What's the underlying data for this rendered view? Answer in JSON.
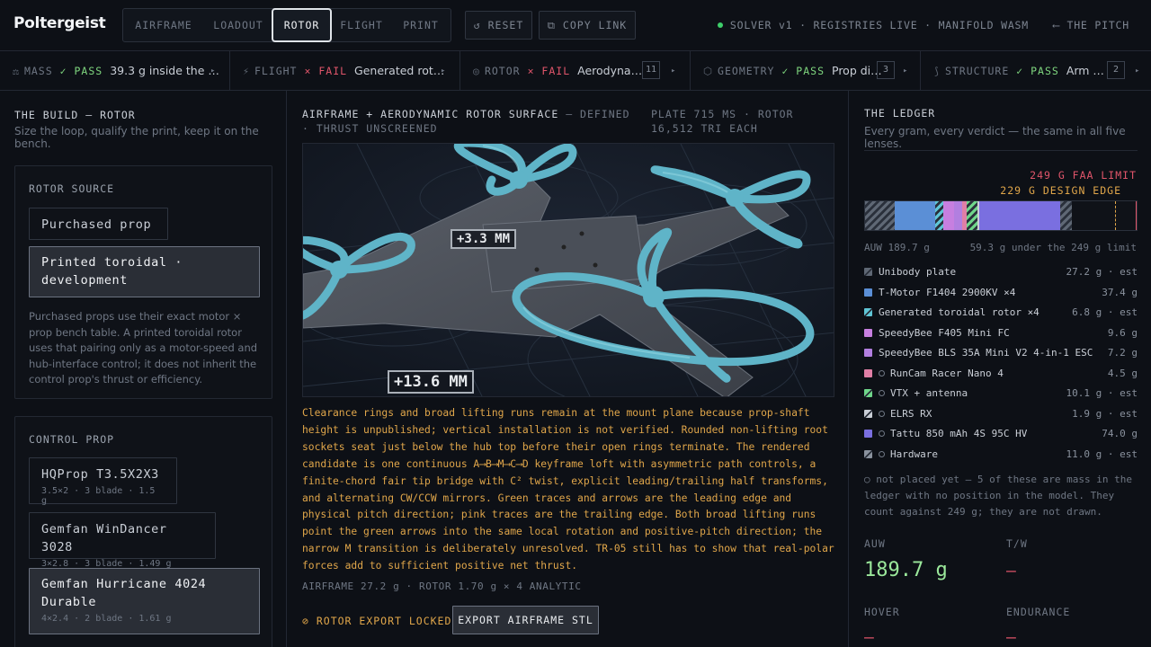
{
  "app": {
    "name": "Poltergeist"
  },
  "header": {
    "modes": [
      "AIRFRAME",
      "LOADOUT",
      "ROTOR",
      "FLIGHT",
      "PRINT"
    ],
    "active_mode": "ROTOR",
    "reset_label": "RESET",
    "copy_link_label": "COPY LINK",
    "status_text": "SOLVER v1 · REGISTRIES LIVE · MANIFOLD WASM",
    "pitch_label": "THE PITCH"
  },
  "checks": [
    {
      "name": "MASS",
      "verdict": "PASS",
      "detail": "39.3 g inside the …",
      "count": ""
    },
    {
      "name": "FLIGHT",
      "verdict": "FAIL",
      "detail": "Generated rot…",
      "count": ""
    },
    {
      "name": "ROTOR",
      "verdict": "FAIL",
      "detail": "Aerodyna…",
      "count": "11"
    },
    {
      "name": "GEOMETRY",
      "verdict": "PASS",
      "detail": "Prop di…",
      "count": "3"
    },
    {
      "name": "STRUCTURE",
      "verdict": "PASS",
      "detail": "Arm …",
      "count": "2"
    }
  ],
  "build": {
    "title": "THE BUILD — ROTOR",
    "subtitle": "Size the loop, qualify the print, keep it on the bench.",
    "rotor_source": {
      "label": "ROTOR SOURCE",
      "options": [
        "Purchased prop",
        "Printed toroidal · development"
      ],
      "selected": "Printed toroidal · development",
      "note": "Purchased props use their exact motor × prop bench table. A printed toroidal rotor uses that pairing only as a motor-speed and hub-interface control; it does not inherit the control prop's thrust or efficiency."
    },
    "control_prop": {
      "label": "CONTROL PROP",
      "options": [
        {
          "name": "HQProp T3.5X2X3",
          "meta": "3.5×2 · 3 blade · 1.5 g"
        },
        {
          "name": "Gemfan WinDancer 3028",
          "meta": "3×2.8 · 3 blade · 1.49 g"
        },
        {
          "name": "Gemfan Hurricane 4024 Durable",
          "meta": "4×2.4 · 2 blade · 1.61 g"
        }
      ],
      "selected": "Gemfan Hurricane 4024 Durable"
    }
  },
  "viewer": {
    "title": "AIRFRAME + AERODYNAMIC ROTOR SURFACE",
    "title_suffix": "— DEFINED · THRUST UNSCREENED",
    "meta": "PLATE 715 MS · ROTOR 16,512 TRI EACH",
    "dim_small": "+3.3 MM",
    "dim_large": "+13.6 MM",
    "description": "Clearance rings and broad lifting runs remain at the mount plane because prop-shaft height is unpublished; vertical installation is not verified. Rounded non-lifting root sockets seat just below the hub top before their open rings terminate. The rendered candidate is one continuous A⟶B⟶M⟶C⟶D keyframe loft with asymmetric path controls, a finite-chord fair tip bridge with C² twist, explicit leading/trailing half transforms, and alternating CW/CCW mirrors. Green traces and arrows are the leading edge and physical pitch direction; pink traces are the trailing edge. Both broad lifting runs point the green arrows into the same local rotation and positive-pitch direction; the narrow M transition is deliberately unresolved. TR-05 still has to show that real-polar forces add to sufficient positive net thrust.",
    "footer": "AIRFRAME 27.2 g · ROTOR 1.70 g × 4 ANALYTIC",
    "lock_label": "ROTOR EXPORT LOCKED",
    "export_label": "EXPORT AIRFRAME STL"
  },
  "ledger": {
    "title": "THE LEDGER",
    "subtitle": "Every gram, every verdict — the same in all five lenses.",
    "faa_limit": "249 G FAA LIMIT",
    "design_edge": "229 G DESIGN EDGE",
    "auw_text": "AUW 189.7 g",
    "margin_text": "59.3 g under the 249 g limit",
    "items": [
      {
        "label": "Unibody plate",
        "value": "27.2 g · est",
        "color": "#5f6875",
        "hatch": true,
        "placed": true
      },
      {
        "label": "T-Motor F1404 2900KV ×4",
        "value": "37.4 g",
        "color": "#5b8fd6",
        "hatch": false,
        "placed": true
      },
      {
        "label": "Generated toroidal rotor ×4",
        "value": "6.8 g · est",
        "color": "#5fc6d6",
        "hatch": true,
        "placed": true
      },
      {
        "label": "SpeedyBee F405 Mini FC",
        "value": "9.6 g",
        "color": "#c77fe0",
        "hatch": false,
        "placed": true
      },
      {
        "label": "SpeedyBee BLS 35A Mini V2 4-in-1 ESC",
        "value": "7.2 g",
        "color": "#b27fe0",
        "hatch": false,
        "placed": true
      },
      {
        "label": "RunCam Racer Nano 4",
        "value": "4.5 g",
        "color": "#e07fa6",
        "hatch": false,
        "placed": false
      },
      {
        "label": "VTX + antenna",
        "value": "10.1 g · est",
        "color": "#6fd68a",
        "hatch": true,
        "placed": false
      },
      {
        "label": "ELRS RX",
        "value": "1.9 g · est",
        "color": "#c9ced6",
        "hatch": true,
        "placed": false
      },
      {
        "label": "Tattu 850 mAh 4S 95C HV",
        "value": "74.0 g",
        "color": "#7a6fe0",
        "hatch": false,
        "placed": false
      },
      {
        "label": "Hardware",
        "value": "11.0 g · est",
        "color": "#8a929e",
        "hatch": true,
        "placed": false
      }
    ],
    "note": "not placed yet — 5 of these are mass in the ledger with no position in the model. They count against 249 g; they are not drawn.",
    "stats": {
      "auw_label": "AUW",
      "auw_value": "189.7 g",
      "tw_label": "T/W",
      "tw_value": "—",
      "hover_label": "HOVER",
      "hover_value": "—",
      "endurance_label": "ENDURANCE",
      "endurance_value": "—"
    }
  }
}
